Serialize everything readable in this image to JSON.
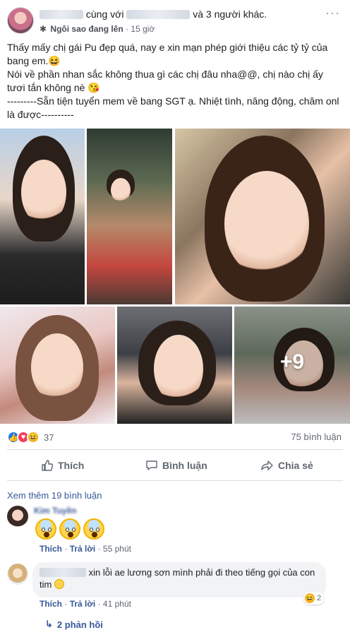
{
  "post": {
    "tagged_suffix": "cùng với",
    "tagged_suffix2": "và 3 người khác.",
    "star_label": "Ngôi sao đang lên",
    "time": "· 15 giờ",
    "menu": "···",
    "text": [
      "Thấy mấy chị gái Pu đẹp quá, nay e xin mạn phép giới thiệu các tỷ tỷ của bang em.😆",
      "Nói về phần nhan sắc không thua gì các chị đâu nha@@, chị nào chị ấy tươi tắn không nè 😘",
      "---------Sẵn tiện tuyển mem về bang SGT ạ. Nhiệt tình, năng động, chăm onl là được----------"
    ],
    "more_photos": "+9"
  },
  "reactions": {
    "count": "37",
    "comments": "75 bình luận",
    "icons": [
      "like-icon",
      "love-icon",
      "haha-icon"
    ],
    "colors": {
      "like": "#1877f2",
      "love": "#f33e58",
      "haha": "#f7b125"
    }
  },
  "actions": {
    "like": "Thích",
    "comment": "Bình luận",
    "share": "Chia sẻ"
  },
  "comments": {
    "see_more": "Xem thêm 19 bình luận",
    "c1": {
      "name": "Kim Tuyền",
      "emoji": [
        "😱",
        "😱",
        "😱"
      ],
      "like": "Thích",
      "reply": "Trả lời",
      "time": "55 phút"
    },
    "c2": {
      "name": "",
      "text": "xin lỗi ae lương sơn mình phải đi theo tiếng gọi của con tim",
      "like": "Thích",
      "reply": "Trả lời",
      "time": "41 phút",
      "react_count": "2"
    },
    "replies": "2 phản hồi"
  }
}
